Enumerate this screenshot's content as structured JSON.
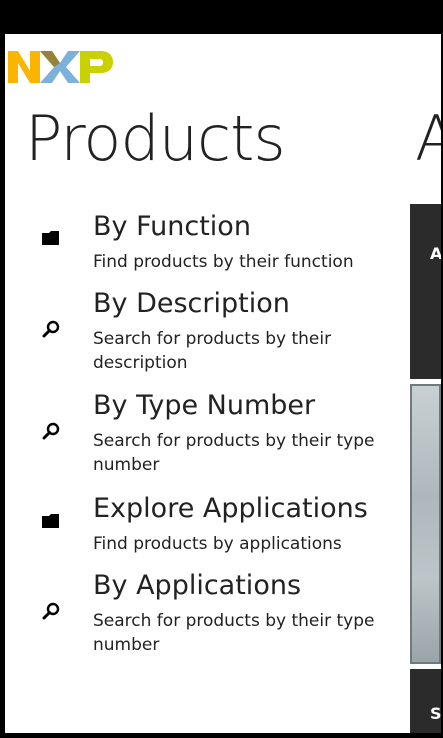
{
  "brand": {
    "logo_text": "NXP"
  },
  "page": {
    "title": "Products",
    "next_pivot_title": "A"
  },
  "items": [
    {
      "name": "By Function",
      "description": "Find products by their function",
      "icon": "folder-icon"
    },
    {
      "name": "By Description",
      "description": "Search for products by their description",
      "icon": "search-icon"
    },
    {
      "name": "By Type Number",
      "description": "Search for products by their type number",
      "icon": "search-icon"
    },
    {
      "name": "Explore Applications",
      "description": "Find products by applications",
      "icon": "folder-icon"
    },
    {
      "name": "By Applications",
      "description": "Search for products by their type number",
      "icon": "search-icon"
    }
  ],
  "side": {
    "tile1_letter": "A",
    "tile2_letter": "S"
  }
}
